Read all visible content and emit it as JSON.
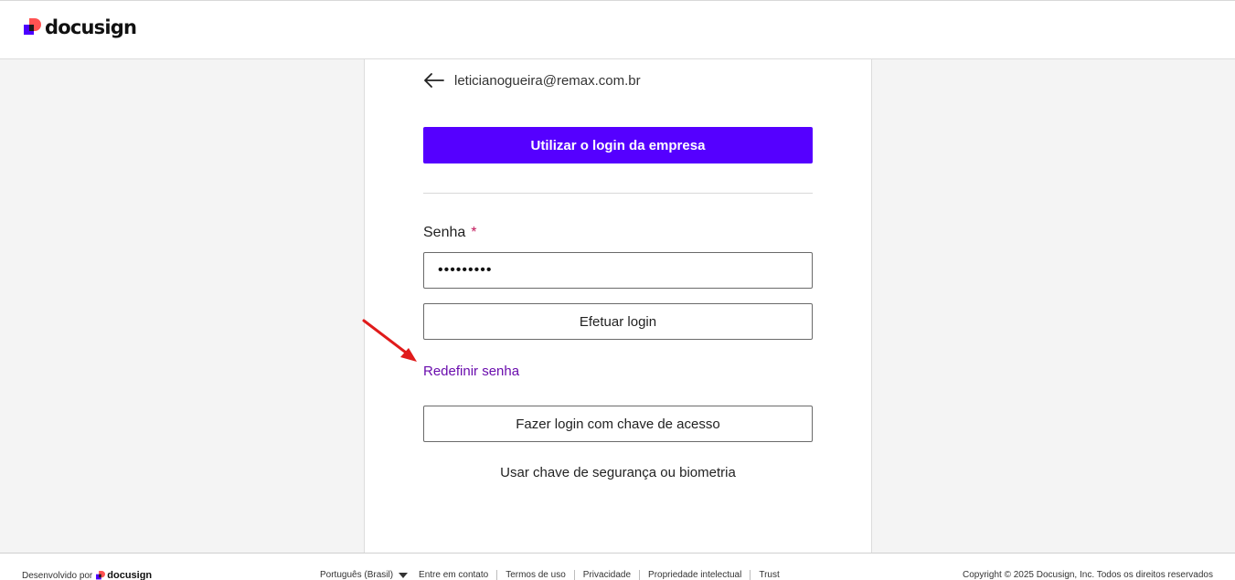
{
  "header": {
    "brand_name": "docusign"
  },
  "login": {
    "email": "leticianogueira@remax.com.br",
    "company_login_label": "Utilizar o login da empresa",
    "password_label": "Senha",
    "required_marker": "*",
    "password_value": "•••••••••",
    "submit_label": "Efetuar login",
    "reset_password_label": "Redefinir senha",
    "passkey_label": "Fazer login com chave de acesso",
    "security_key_label": "Usar chave de segurança ou biometria"
  },
  "footer": {
    "powered_by": "Desenvolvido por",
    "brand_name": "docusign",
    "language": "Português (Brasil)",
    "links": [
      "Entre em contato",
      "Termos de uso",
      "Privacidade",
      "Propriedade intelectual",
      "Trust"
    ],
    "copyright": "Copyright © 2025 Docusign, Inc. Todos os direitos reservados"
  },
  "colors": {
    "primary": "#5500ff",
    "link": "#6a0dad",
    "required": "#c2185b",
    "annotation_arrow": "#e01b1b"
  },
  "icons": {
    "back": "arrow-left-icon",
    "language_dropdown": "caret-down-icon",
    "annotation": "red-arrow-annotation"
  }
}
